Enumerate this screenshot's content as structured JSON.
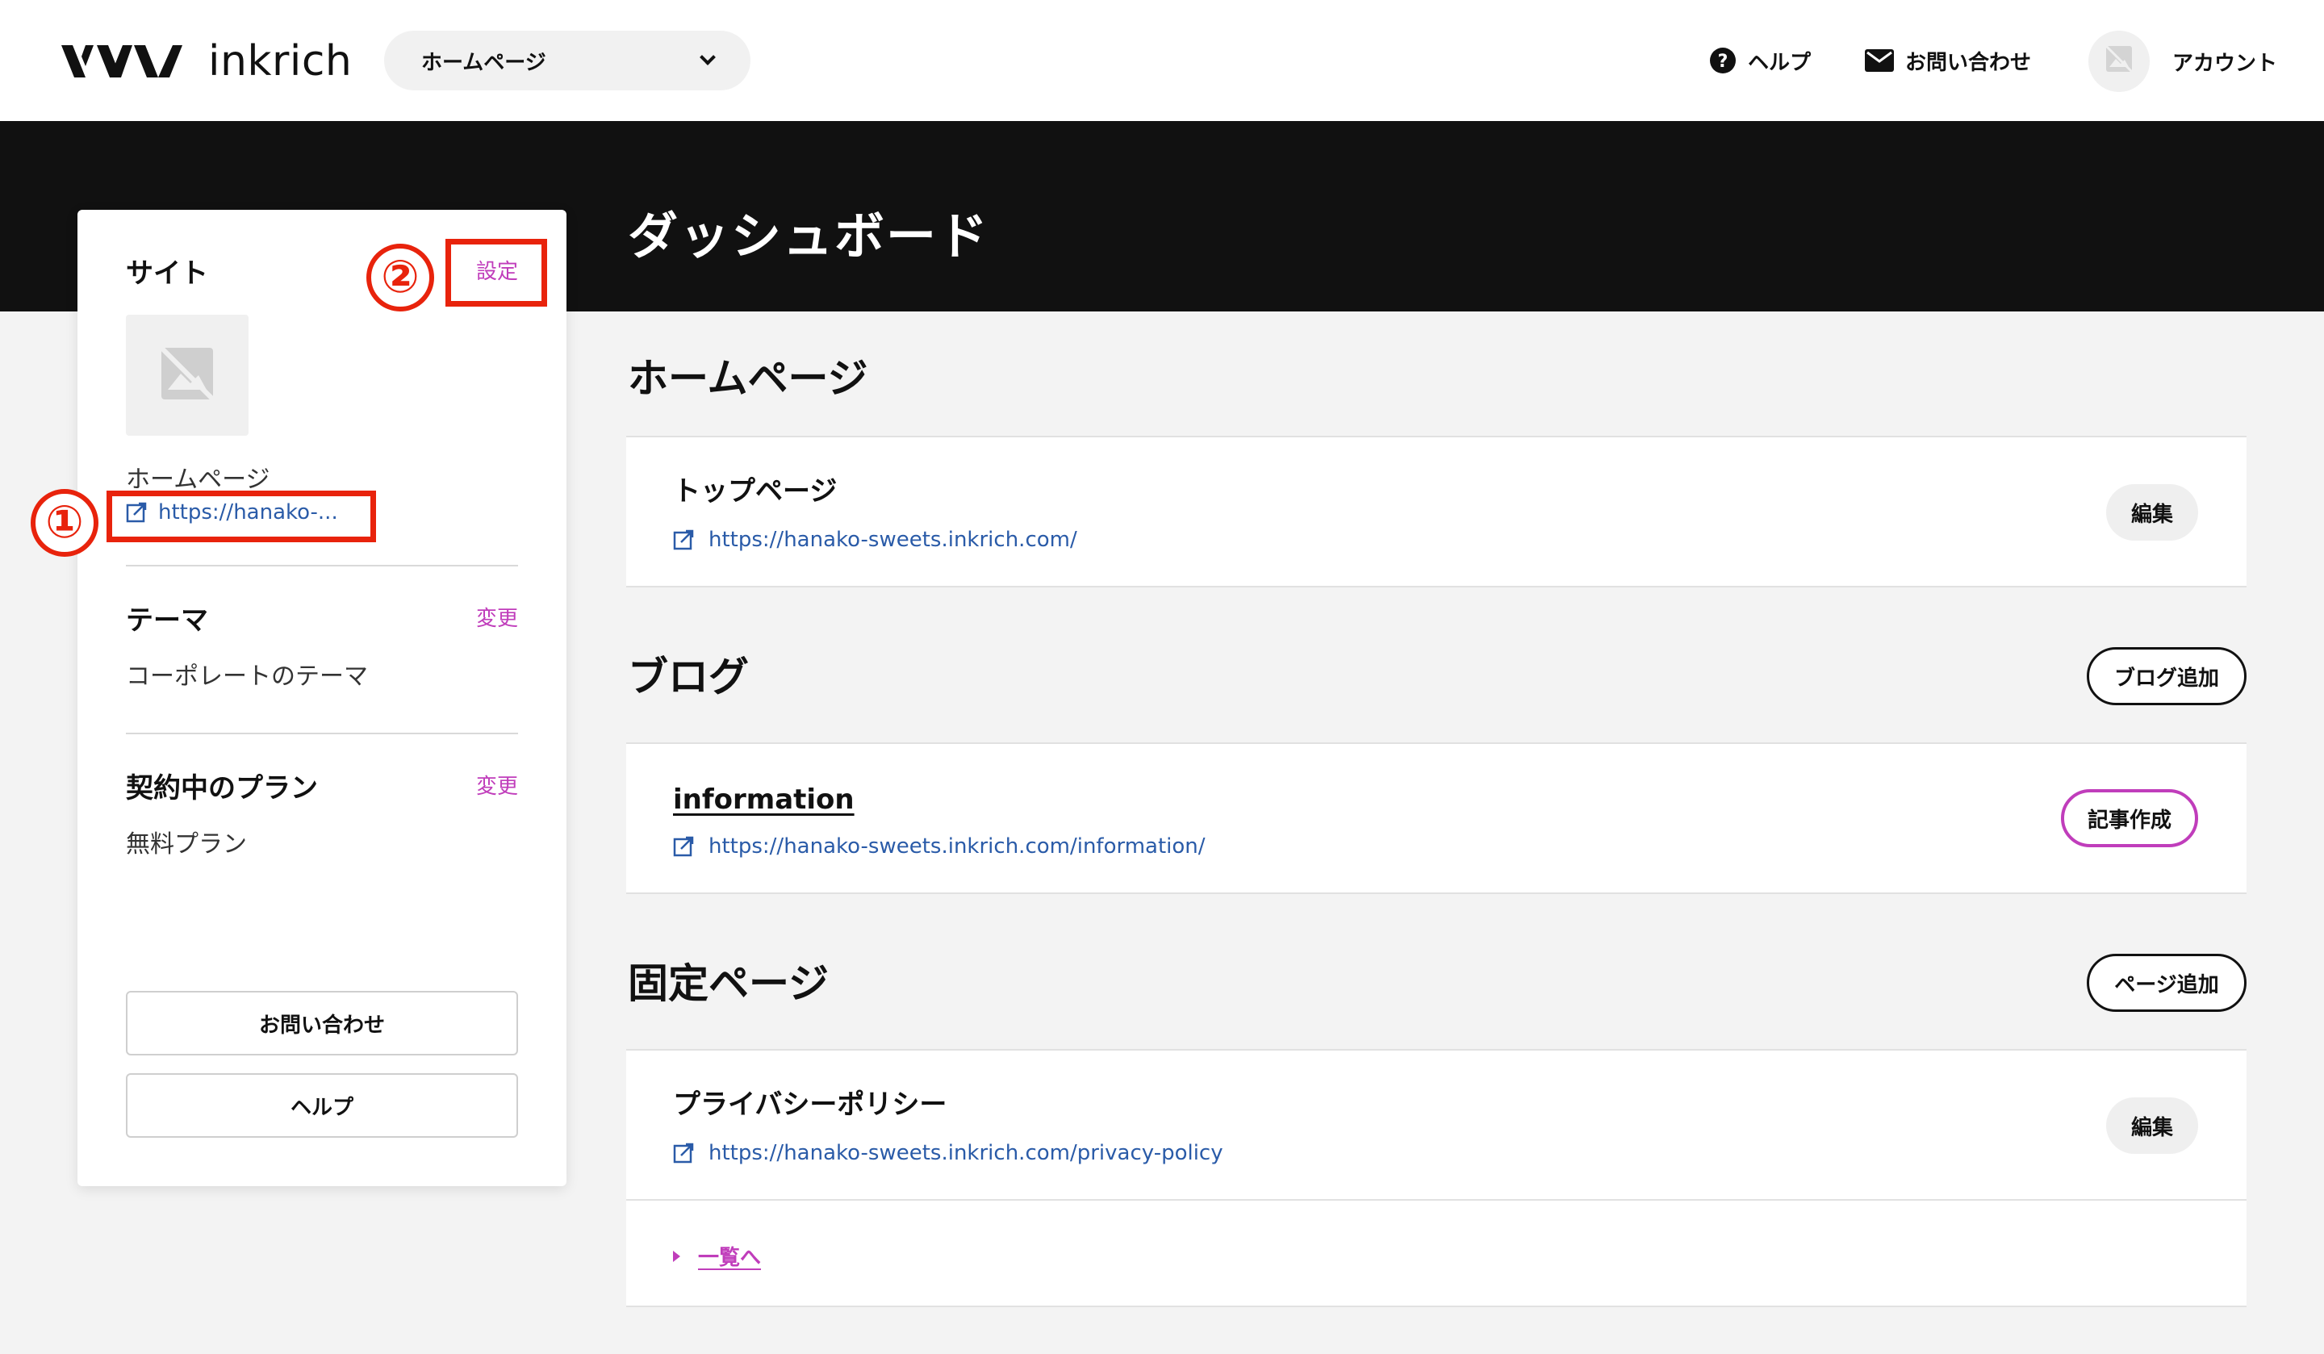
{
  "header": {
    "logo_text": "inkrich",
    "site_selector": {
      "selected": "ホームページ"
    },
    "help_label": "ヘルプ",
    "contact_label": "お問い合わせ",
    "account_label": "アカウント"
  },
  "page_title": "ダッシュボード",
  "sidebar": {
    "site": {
      "title": "サイト",
      "settings_link": "設定",
      "site_name": "ホームページ",
      "site_url": "https://hanako-..."
    },
    "theme": {
      "title": "テーマ",
      "change_link": "変更",
      "value": "コーポレートのテーマ"
    },
    "plan": {
      "title": "契約中のプラン",
      "change_link": "変更",
      "value": "無料プラン"
    },
    "contact_button": "お問い合わせ",
    "help_button": "ヘルプ"
  },
  "annotations": {
    "one": "①",
    "two": "②",
    "color": "#e8230c"
  },
  "homepage_section": {
    "title": "ホームページ",
    "item": {
      "title": "トップページ",
      "url": "https://hanako-sweets.inkrich.com/",
      "edit_label": "編集"
    }
  },
  "blog_section": {
    "title": "ブログ",
    "add_label": "ブログ追加",
    "item": {
      "title": "information",
      "url": "https://hanako-sweets.inkrich.com/information/",
      "create_label": "記事作成"
    }
  },
  "fixed_section": {
    "title": "固定ページ",
    "add_label": "ページ追加",
    "item": {
      "title": "プライバシーポリシー",
      "url": "https://hanako-sweets.inkrich.com/privacy-policy",
      "edit_label": "編集"
    },
    "list_link": "一覧へ"
  },
  "colors": {
    "accent": "#c03dbb",
    "link": "#2a5ba8",
    "dark_band": "#111111"
  },
  "icons": [
    "question-circle-icon",
    "mail-icon",
    "no-image-icon",
    "external-link-icon",
    "chevron-down-icon",
    "caret-right-icon"
  ]
}
